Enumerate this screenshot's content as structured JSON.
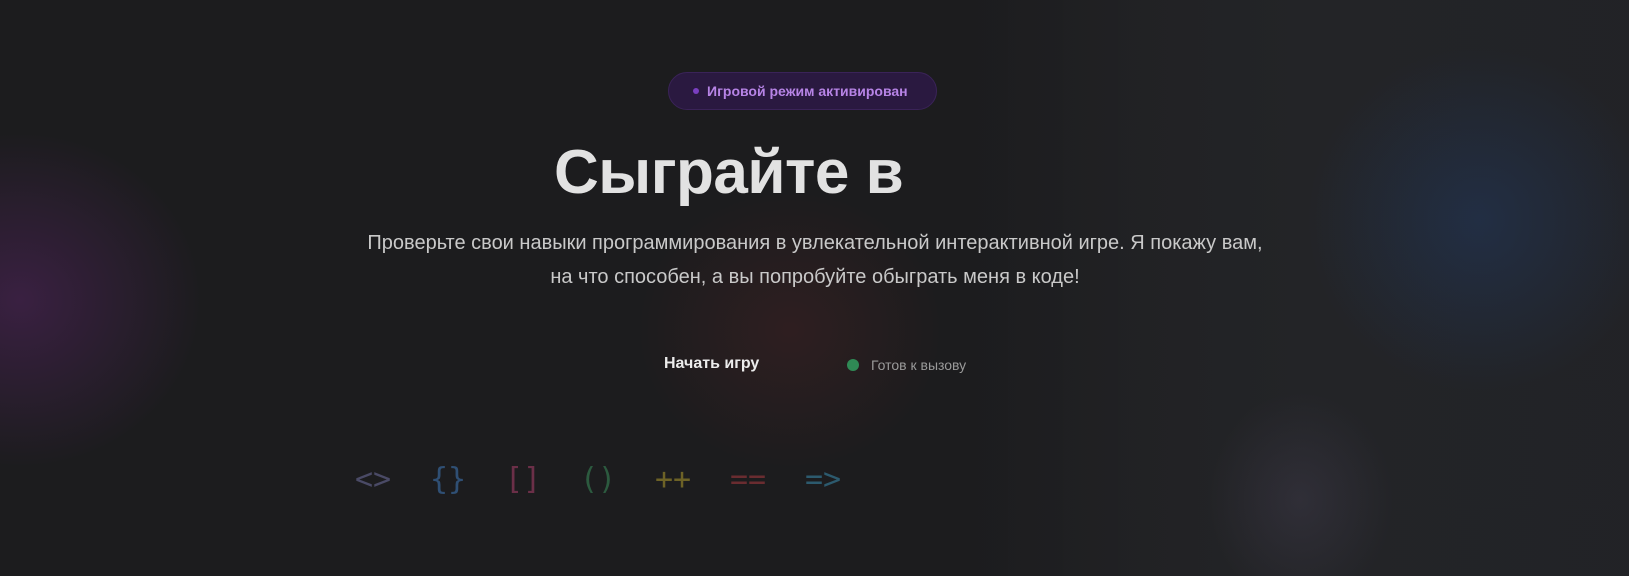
{
  "badge": {
    "text": "Игровой режим активирован",
    "accent_color": "#7a3fc0"
  },
  "hero": {
    "title": "Сыграйте в",
    "subtitle": "Проверьте свои навыки программирования в увлекательной интерактивной игре. Я покажу вам, на что способен, а вы попробуйте обыграть меня в коде!"
  },
  "actions": {
    "start_label": "Начать игру",
    "status_text": "Готов к вызову",
    "status_color": "#2f8a55"
  },
  "code_symbols": [
    {
      "text": "<>",
      "color": "#4a4a66"
    },
    {
      "text": "{}",
      "color": "#2f4f74"
    },
    {
      "text": "[]",
      "color": "#6b2f48"
    },
    {
      "text": "()",
      "color": "#2c5a3f"
    },
    {
      "text": "++",
      "color": "#6d6226"
    },
    {
      "text": "==",
      "color": "#6a2c30"
    },
    {
      "text": "=>",
      "color": "#2c5a6e"
    }
  ]
}
